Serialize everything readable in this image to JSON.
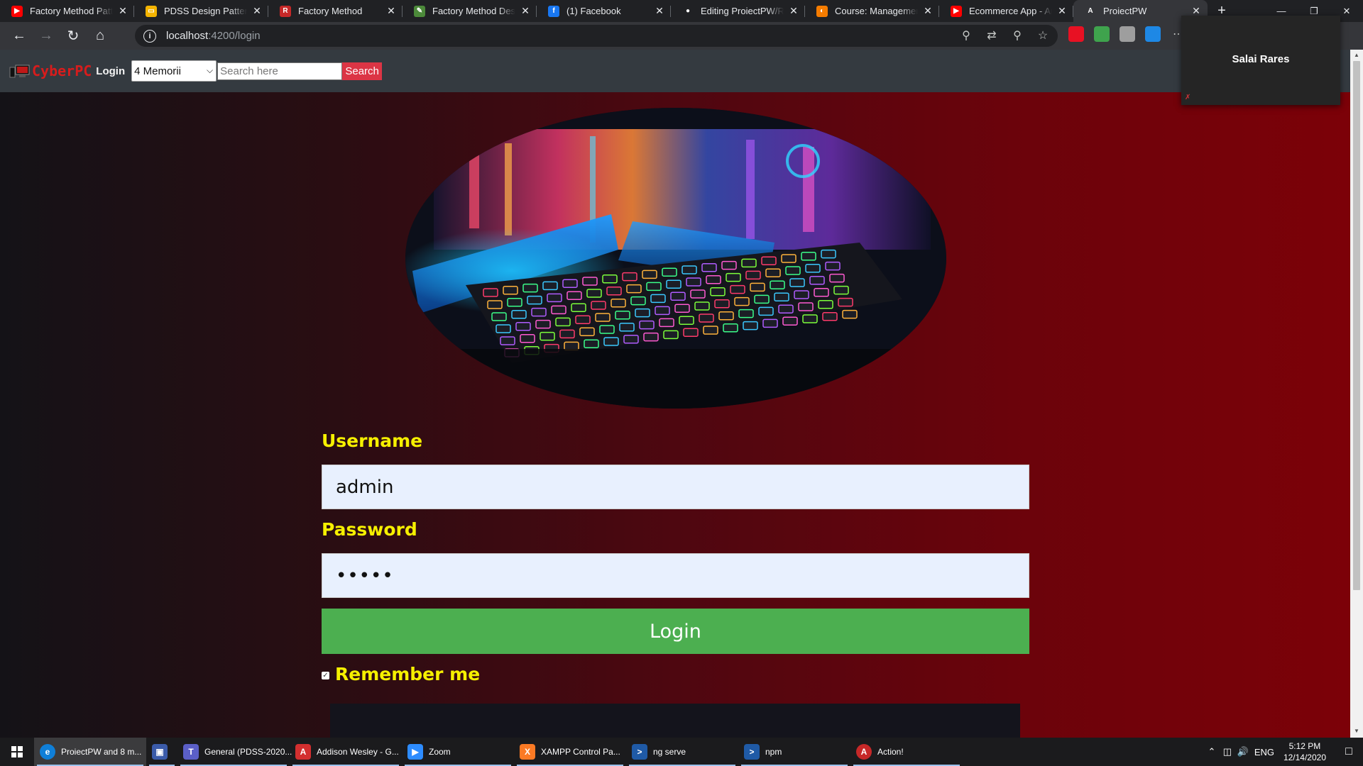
{
  "browser": {
    "tabs": [
      {
        "title": "Factory Method Pattern",
        "favicon": "youtube-icon",
        "color": "#ff0000"
      },
      {
        "title": "PDSS Design Patterns -",
        "favicon": "slides-icon",
        "color": "#f4b400"
      },
      {
        "title": "Factory Method",
        "favicon": "refactoring-icon",
        "color": "#c62828"
      },
      {
        "title": "Factory Method Design",
        "favicon": "leaf-icon",
        "color": "#4c8a3a"
      },
      {
        "title": "(1) Facebook",
        "favicon": "facebook-icon",
        "color": "#1877f2"
      },
      {
        "title": "Editing ProiectPW/REA",
        "favicon": "github-icon",
        "color": "#ffffff"
      },
      {
        "title": "Course: Management &",
        "favicon": "moodle-icon",
        "color": "#f57c00"
      },
      {
        "title": "Ecommerce App - Ang",
        "favicon": "youtube-icon",
        "color": "#ff0000"
      },
      {
        "title": "ProiectPW",
        "favicon": "angular-icon",
        "color": "#ffffff",
        "active": true
      }
    ],
    "url_host": "localhost",
    "url_path": ":4200/login",
    "extension_colors": [
      "#e81123",
      "#3fa34d",
      "#9e9e9e",
      "#1e88e5"
    ]
  },
  "site": {
    "brand": "CyberPC",
    "nav_login": "Login",
    "memory_select_value": "4 Memorii",
    "search_placeholder": "Search here",
    "search_button": "Search"
  },
  "login": {
    "username_label": "Username",
    "username_value": "admin",
    "password_label": "Password",
    "password_value": "•••••",
    "submit_label": "Login",
    "remember_label": "Remember me",
    "remember_checked": true
  },
  "call": {
    "participant_name": "Salai Rares"
  },
  "taskbar": {
    "items": [
      {
        "label": "ProiectPW and 8 m...",
        "icon": "edge-icon",
        "color": "#0f7fd8",
        "active": true
      },
      {
        "label": "",
        "icon": "floppy-icon",
        "color": "#3b5ba9"
      },
      {
        "label": "General (PDSS-2020...",
        "icon": "teams-icon",
        "color": "#5b5fc7"
      },
      {
        "label": "Addison Wesley - G...",
        "icon": "pdf-icon",
        "color": "#d32f2f"
      },
      {
        "label": "Zoom",
        "icon": "zoom-icon",
        "color": "#2d8cff"
      },
      {
        "label": "XAMPP Control Pa...",
        "icon": "xampp-icon",
        "color": "#fb7a24"
      },
      {
        "label": "ng serve",
        "icon": "powershell-icon",
        "color": "#1f5aa6"
      },
      {
        "label": "npm",
        "icon": "powershell-icon",
        "color": "#1f5aa6"
      },
      {
        "label": "Action!",
        "icon": "action-icon",
        "color": "#c62828"
      }
    ],
    "language": "ENG",
    "time": "5:12 PM",
    "date": "12/14/2020"
  }
}
